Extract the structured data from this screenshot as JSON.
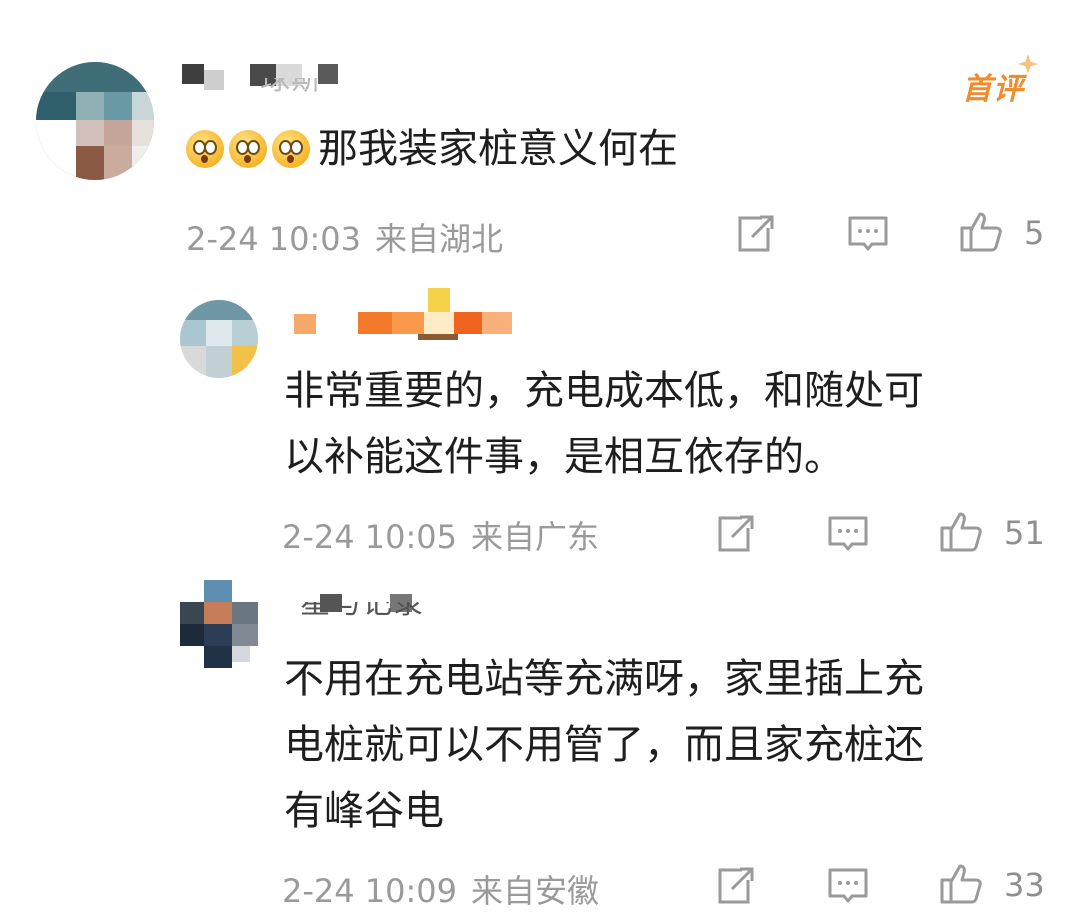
{
  "colors": {
    "background": "#ffffff",
    "text_primary": "#1e1e1e",
    "text_meta": "#9a9a9a",
    "badge": "#f28b2b",
    "icon": "#9a9a9a"
  },
  "comments": [
    {
      "username_visible": "球斯",
      "badge": "首评",
      "emoji_icon": "shocked-face-icon",
      "text": "那我装家桩意义何在",
      "time": "2-24 10:03",
      "location": "来自湖北",
      "likes": "5"
    },
    {
      "username_visible": "",
      "text_lines": [
        "非常重要的，充电成本低，和随处可",
        "以补能这件事，是相互依存的。"
      ],
      "time": "2-24 10:05",
      "location": "来自广东",
      "likes": "51"
    },
    {
      "username_visible": "星与记录",
      "text_lines": [
        "不用在充电站等充满呀，家里插上充",
        "电桩就可以不用管了，而且家充桩还",
        "有峰谷电"
      ],
      "time": "2-24 10:09",
      "location": "来自安徽",
      "likes": "33"
    }
  ],
  "icons": {
    "share": "share-icon",
    "reply": "comment-icon",
    "like": "thumbs-up-icon"
  }
}
